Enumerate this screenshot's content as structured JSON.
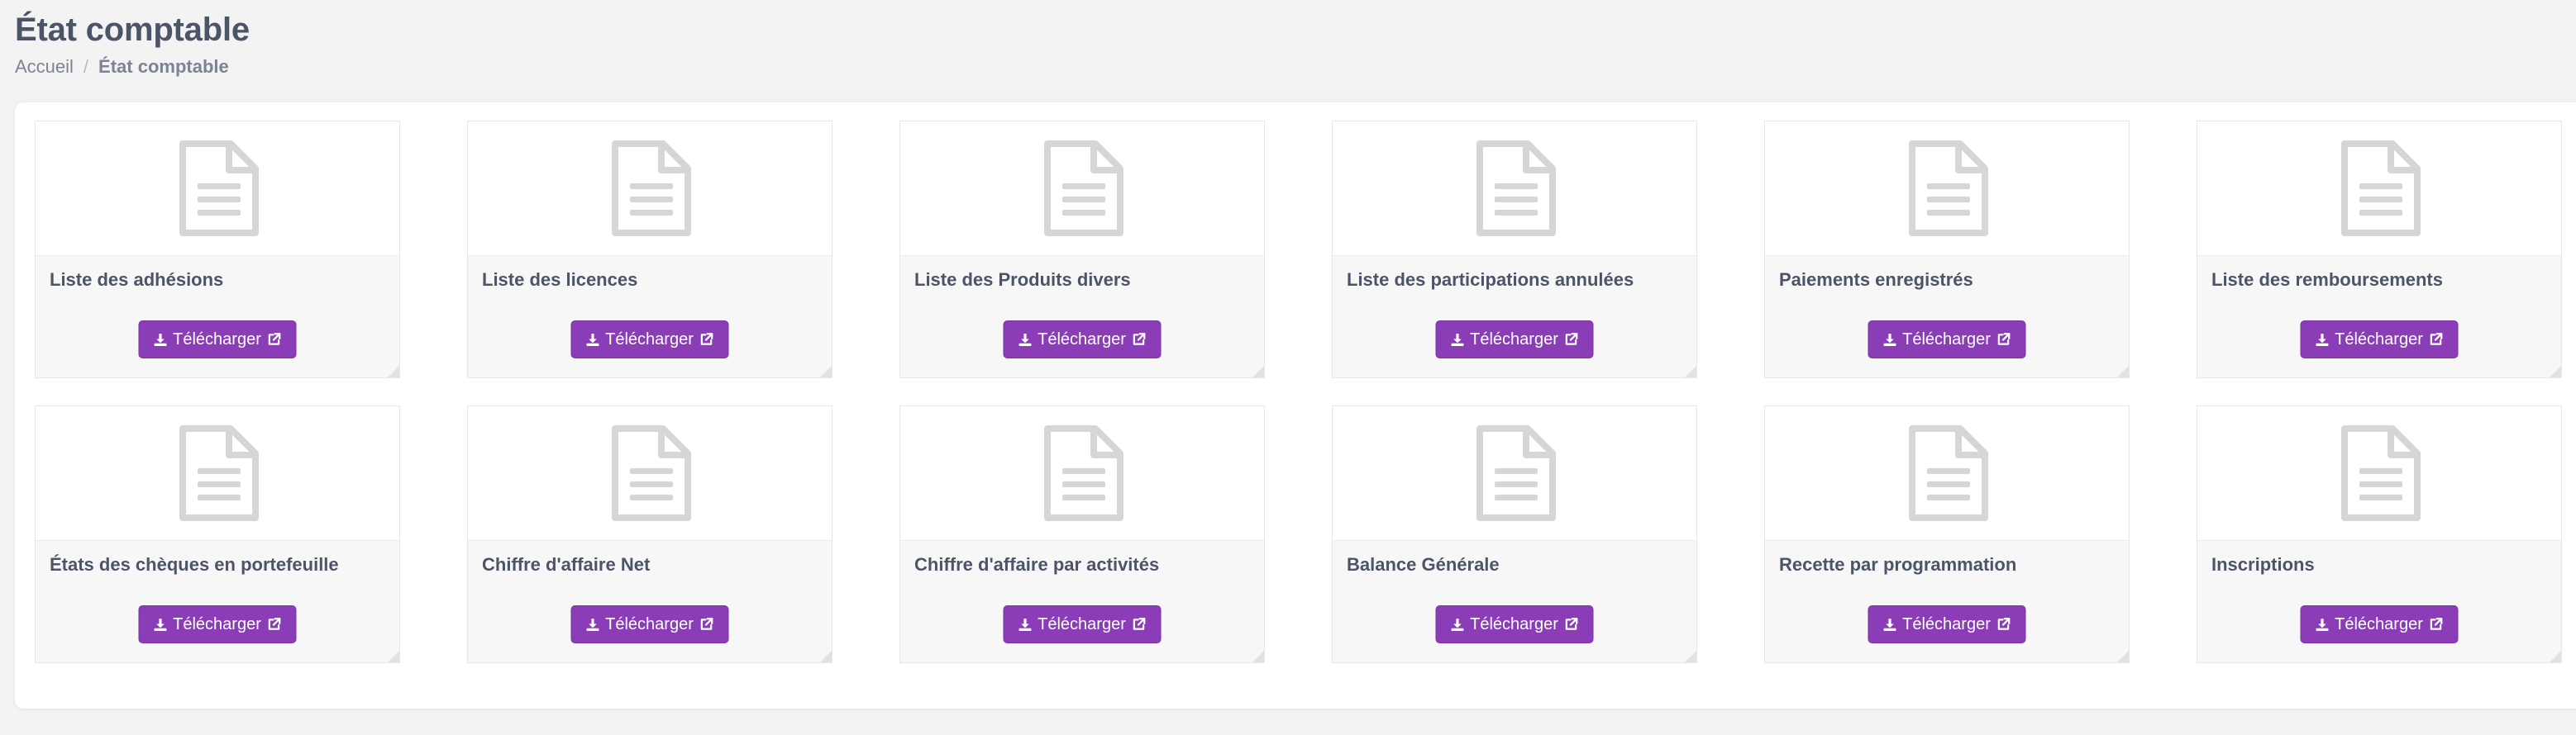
{
  "page": {
    "title": "État comptable",
    "breadcrumb": {
      "home": "Accueil",
      "separator": "/",
      "current": "État comptable"
    }
  },
  "colors": {
    "accent": "#8a3db6",
    "icon": "#d6d6d6",
    "title": "#4b5567"
  },
  "icons": {
    "card": "file-text-icon",
    "download": "download-icon",
    "external": "external-link-icon"
  },
  "reports": [
    {
      "title": "Liste des adhésions",
      "button_label": "Télécharger"
    },
    {
      "title": "Liste des licences",
      "button_label": "Télécharger"
    },
    {
      "title": "Liste des Produits divers",
      "button_label": "Télécharger"
    },
    {
      "title": "Liste des participations annulées",
      "button_label": "Télécharger"
    },
    {
      "title": "Paiements enregistrés",
      "button_label": "Télécharger"
    },
    {
      "title": "Liste des remboursements",
      "button_label": "Télécharger"
    },
    {
      "title": "États des chèques en portefeuille",
      "button_label": "Télécharger"
    },
    {
      "title": "Chiffre d'affaire Net",
      "button_label": "Télécharger"
    },
    {
      "title": "Chiffre d'affaire par activités",
      "button_label": "Télécharger"
    },
    {
      "title": "Balance Générale",
      "button_label": "Télécharger"
    },
    {
      "title": "Recette par programmation",
      "button_label": "Télécharger"
    },
    {
      "title": "Inscriptions",
      "button_label": "Télécharger"
    }
  ]
}
